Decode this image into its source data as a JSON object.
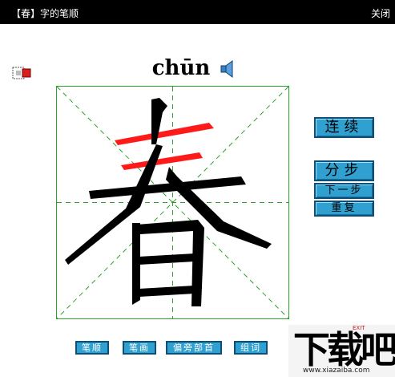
{
  "window": {
    "title": "【春】字的笔顺",
    "close_label": "关闭"
  },
  "character": {
    "glyph": "春",
    "pinyin": "chūn",
    "stroke_color": "#000000",
    "highlight_color": "#ff1a1a",
    "grid_color": "#2ea02e"
  },
  "controls": {
    "continuous_label": "连续",
    "step_label": "分步",
    "next_step_label": "下一步",
    "repeat_label": "重复",
    "button_color": "#2fa0d0"
  },
  "bottom_tabs": {
    "stroke_order": "笔顺",
    "strokes": "笔画",
    "radical": "偏旁部首",
    "words": "组词"
  },
  "brand": {
    "exit_label": "EXIT",
    "logo_text": "下载吧",
    "url": "www.xiazaiba.com"
  }
}
